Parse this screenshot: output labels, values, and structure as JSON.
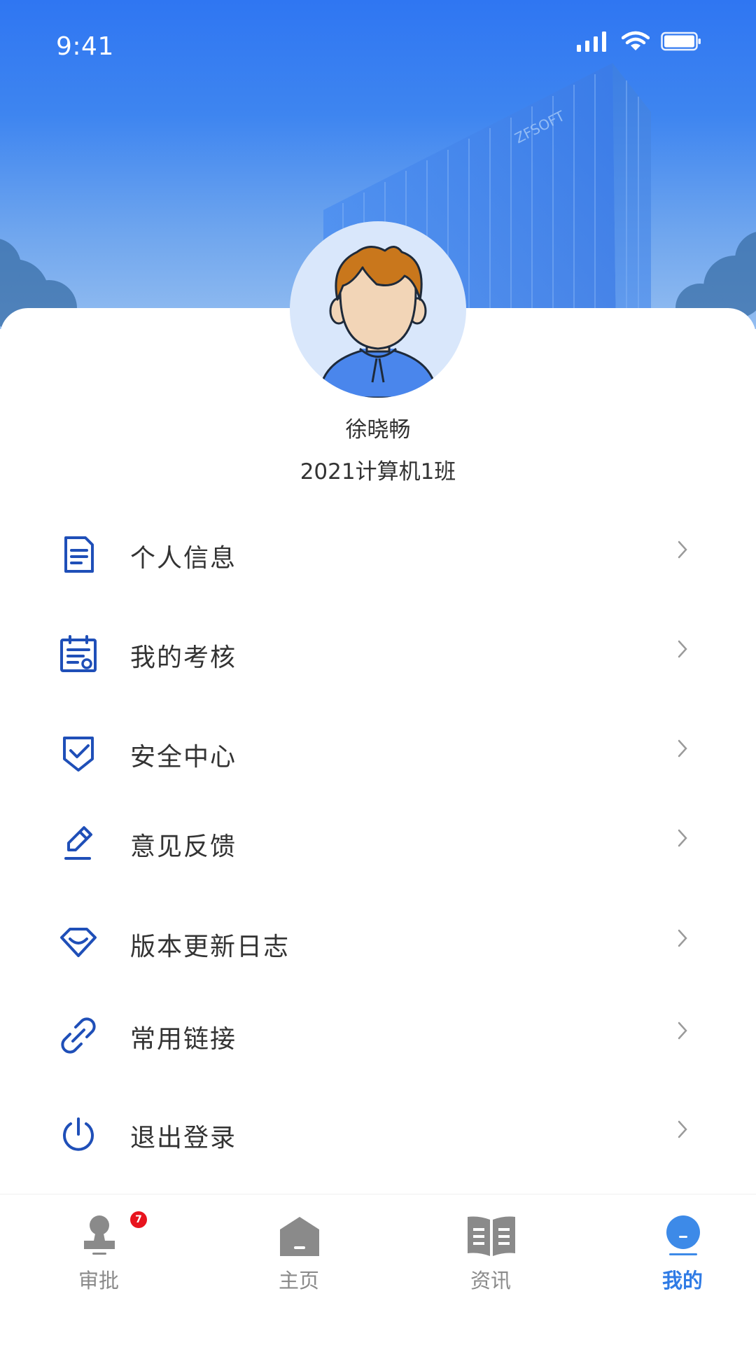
{
  "status_bar": {
    "time": "9:41",
    "icons": [
      "signal-icon",
      "wifi-icon",
      "battery-icon"
    ]
  },
  "header": {
    "building_sign": "ZFSOFT"
  },
  "profile": {
    "name": "徐晓畅",
    "class_name": "2021计算机1班"
  },
  "menu": {
    "items": [
      {
        "label": "个人信息",
        "icon": "document-icon"
      },
      {
        "label": "我的考核",
        "icon": "assessment-icon"
      },
      {
        "label": "安全中心",
        "icon": "shield-check-icon"
      },
      {
        "label": "意见反馈",
        "icon": "pen-icon"
      },
      {
        "label": "版本更新日志",
        "icon": "diamond-icon"
      },
      {
        "label": "常用链接",
        "icon": "link-icon"
      },
      {
        "label": "退出登录",
        "icon": "power-icon"
      }
    ]
  },
  "tabbar": {
    "tabs": [
      {
        "label": "审批",
        "icon": "stamp-icon",
        "badge": "7"
      },
      {
        "label": "主页",
        "icon": "home-icon"
      },
      {
        "label": "资讯",
        "icon": "book-icon"
      },
      {
        "label": "我的",
        "icon": "user-icon",
        "active": true
      }
    ]
  },
  "colors": {
    "accent": "#2f7be5",
    "icon_blue": "#1f4fb8",
    "text": "#333333",
    "tab_inactive": "#8a8a8a",
    "badge": "#e8141e"
  }
}
